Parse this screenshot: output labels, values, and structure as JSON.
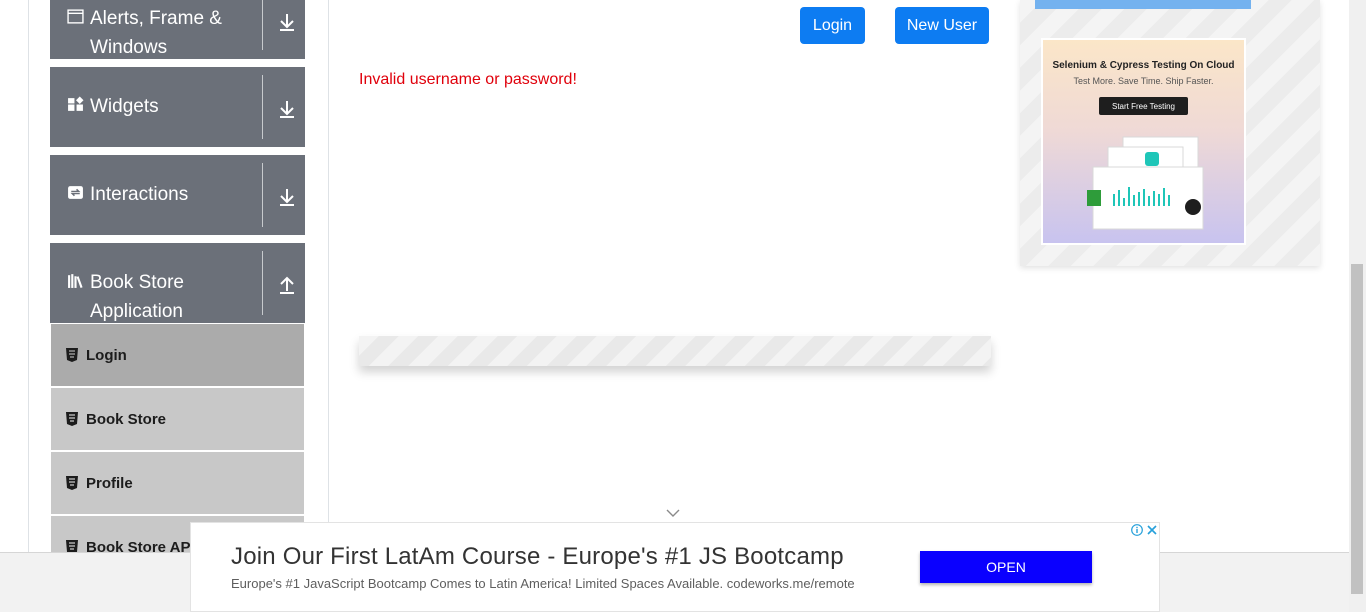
{
  "sidebar": {
    "groups": [
      {
        "label": "Alerts, Frame & Windows",
        "icon": "window-icon",
        "state": "collapsed"
      },
      {
        "label": "Widgets",
        "icon": "widgets-icon",
        "state": "collapsed"
      },
      {
        "label": "Interactions",
        "icon": "interactions-icon",
        "state": "collapsed"
      },
      {
        "label": "Book Store Application",
        "icon": "books-icon",
        "state": "expanded"
      }
    ],
    "book_store_items": [
      {
        "label": "Login",
        "active": true
      },
      {
        "label": "Book Store",
        "active": false
      },
      {
        "label": "Profile",
        "active": false
      },
      {
        "label": "Book Store API",
        "active": false
      }
    ]
  },
  "header": {
    "login_label": "Login",
    "new_user_label": "New User"
  },
  "main": {
    "error_message": "Invalid username or password!"
  },
  "side_ad": {
    "title": "Selenium & Cypress Testing On Cloud",
    "subtitle": "Test More. Save Time. Ship Faster.",
    "cta": "Start Free Testing"
  },
  "banner_ad": {
    "title": "Join Our First LatAm Course - Europe's #1 JS Bootcamp",
    "description": "Europe's #1 JavaScript Bootcamp Comes to Latin America! Limited Spaces Available. codeworks.me/remote",
    "open_label": "OPEN"
  },
  "colors": {
    "sidebar_group": "#6b7079",
    "menu_item": "#c8c8c8",
    "menu_item_active": "#ababab",
    "primary_button": "#0d7cf2",
    "error_text": "#e0000b",
    "banner_open": "#0a00ff"
  }
}
